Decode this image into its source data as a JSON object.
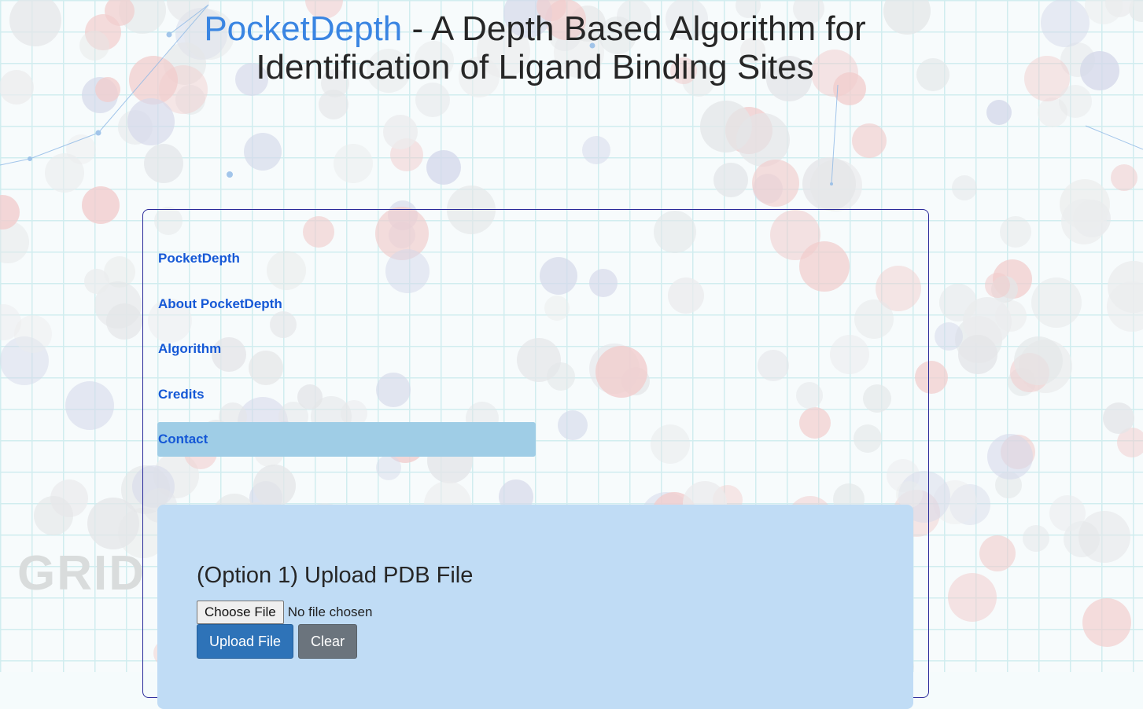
{
  "header": {
    "brand": "PocketDepth",
    "title_rest_line1": " - A Depth Based Algorithm for",
    "title_line2": "Identification of Ligand Binding Sites"
  },
  "background": {
    "watermark": "GRID"
  },
  "nav": {
    "items": [
      {
        "label": "PocketDepth"
      },
      {
        "label": "About PocketDepth"
      },
      {
        "label": "Algorithm"
      },
      {
        "label": "Credits"
      },
      {
        "label": "Contact",
        "active": true
      }
    ]
  },
  "upload": {
    "heading": "(Option 1) Upload PDB File",
    "choose_label": "Choose File",
    "file_status": "No file chosen",
    "upload_label": "Upload File",
    "clear_label": "Clear"
  },
  "colors": {
    "brand": "#3a85e2",
    "nav_link": "#1558d6",
    "nav_active_bg": "#9fcde6",
    "upload_panel_bg": "#c0dcf5",
    "primary_button": "#2e73b8",
    "secondary_button": "#6b747d"
  }
}
